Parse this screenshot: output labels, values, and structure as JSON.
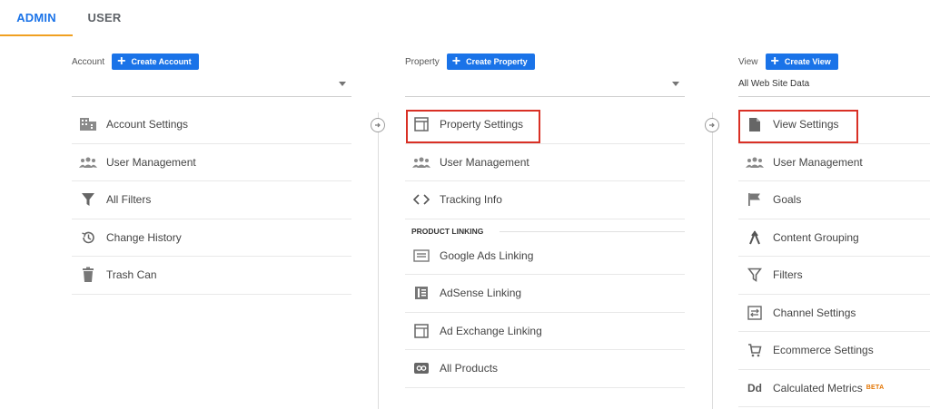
{
  "tabs": {
    "admin": "ADMIN",
    "user": "USER"
  },
  "account": {
    "label": "Account",
    "create_label": "Create Account",
    "selected": "",
    "items": [
      "Account Settings",
      "User Management",
      "All Filters",
      "Change History",
      "Trash Can"
    ]
  },
  "property": {
    "label": "Property",
    "create_label": "Create Property",
    "selected": "",
    "items": [
      "Property Settings",
      "User Management",
      "Tracking Info"
    ],
    "section": "PRODUCT LINKING",
    "linking": [
      "Google Ads Linking",
      "AdSense Linking",
      "Ad Exchange Linking",
      "All Products"
    ]
  },
  "view": {
    "label": "View",
    "create_label": "Create View",
    "selected": "All Web Site Data",
    "items": [
      "View Settings",
      "User Management",
      "Goals",
      "Content Grouping",
      "Filters",
      "Channel Settings",
      "Ecommerce Settings",
      "Calculated Metrics"
    ],
    "beta": "BETA"
  },
  "colors": {
    "accent": "#1a73e8",
    "tab_underline": "#f0a020",
    "highlight": "#d93025",
    "beta": "#e37400"
  }
}
